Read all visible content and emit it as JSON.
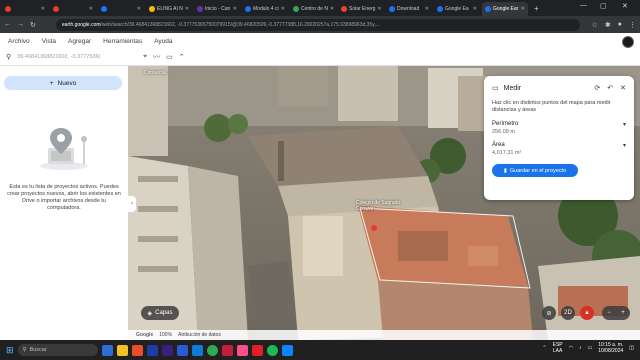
{
  "browser": {
    "tabs": [
      {
        "label": "",
        "color": "#e53935"
      },
      {
        "label": "",
        "color": "#e53935"
      },
      {
        "label": "",
        "color": "#1877f2"
      },
      {
        "label": "ELING AI N",
        "color": "#fbbc04"
      },
      {
        "label": "Inicio - Can",
        "color": "#5e35b1"
      },
      {
        "label": "Modulo 4 ci",
        "color": "#1a73e8"
      },
      {
        "label": "Centro de N",
        "color": "#34a853"
      },
      {
        "label": "Solar Energ",
        "color": "#ea4335"
      },
      {
        "label": "Download",
        "color": "#1a73e8"
      },
      {
        "label": "Google Ea",
        "color": "#1a73e8"
      },
      {
        "label": "Google Ear",
        "color": "#1a73e8",
        "active": true
      }
    ],
    "url_host": "earth.google.com",
    "url_path": "/web/search/39.46841368821602, -0.37775365750079915/@39.46820509,-0.37777388,16.29020257a,175.93898963d,35y,...",
    "window_controls": {
      "minimize": "—",
      "maximize": "▢",
      "close": "✕"
    }
  },
  "menubar": {
    "items": [
      "Archivo",
      "Vista",
      "Agregar",
      "Herramientas",
      "Ayuda"
    ]
  },
  "toolbar": {
    "search_value": "39.46841368821602, -0.3777536(",
    "icons": [
      "search-icon",
      "pin-icon",
      "path-icon",
      "ruler-icon",
      "chevron-up-icon"
    ]
  },
  "sidebar": {
    "new_label": "Nuevo",
    "empty_text": "Esta es tu lista de proyectos activos. Puedes crear proyectos nuevos, abrir los existentes en Drive o importar archivos desde tu computadora."
  },
  "map": {
    "label_building": "Colegio de Sagrado Corazón",
    "label_comercial": "Comercial"
  },
  "measure": {
    "title": "Medir",
    "description": "Haz clic en distintos puntos del mapa para medir distancias y áreas",
    "perimeter_label": "Perímetro",
    "perimeter_value": "256.09 m",
    "area_label": "Área",
    "area_value": "4,017.31 m²",
    "save_label": "Guardar en el proyecto"
  },
  "map_controls": {
    "layers_label": "Capas",
    "view_2d_label": "2D"
  },
  "map_footer": {
    "google": "Google",
    "zoom": "100%",
    "attribution": "Atribución de datos"
  },
  "taskbar": {
    "search_placeholder": "Buscar",
    "lang_top": "ESP",
    "lang_bottom": "LAA",
    "time": "10:15 a. m.",
    "date": "10/08/2024"
  }
}
